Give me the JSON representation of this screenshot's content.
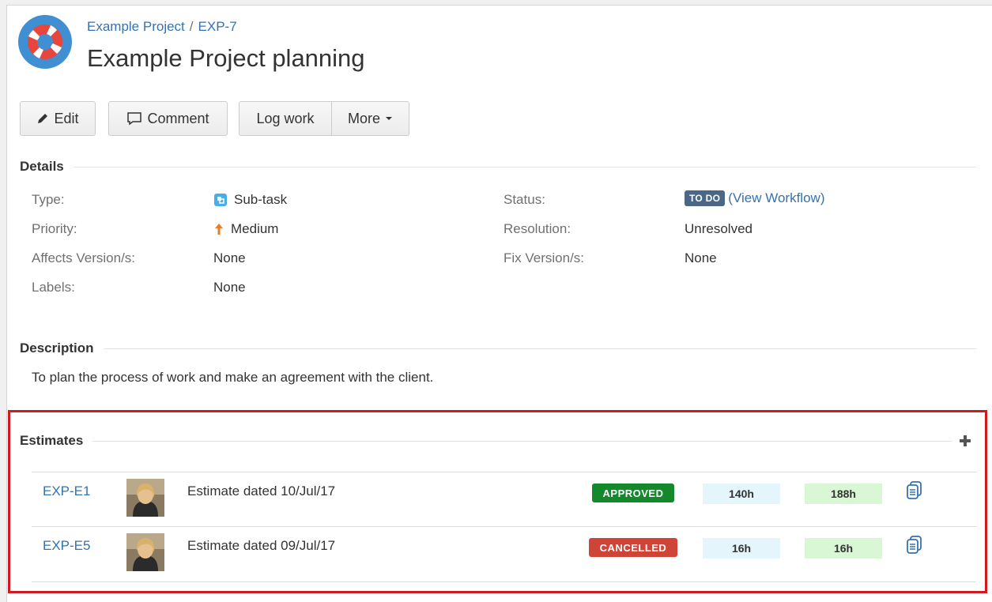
{
  "header": {
    "breadcrumb_project": "Example Project",
    "breadcrumb_sep": "/",
    "breadcrumb_issue": "EXP-7",
    "title": "Example Project planning",
    "project_icon": "lifebuoy-icon"
  },
  "toolbar": {
    "edit_label": "Edit",
    "comment_label": "Comment",
    "log_work_label": "Log work",
    "more_label": "More"
  },
  "details": {
    "heading": "Details",
    "type_label": "Type:",
    "type_value": "Sub-task",
    "priority_label": "Priority:",
    "priority_value": "Medium",
    "affects_label": "Affects Version/s:",
    "affects_value": "None",
    "labels_label": "Labels:",
    "labels_value": "None",
    "status_label": "Status:",
    "status_value": "TO DO",
    "view_workflow": "View Workflow",
    "resolution_label": "Resolution:",
    "resolution_value": "Unresolved",
    "fix_label": "Fix Version/s:",
    "fix_value": "None"
  },
  "description": {
    "heading": "Description",
    "text": "To plan the process of work and make an agreement with the client."
  },
  "estimates": {
    "heading": "Estimates",
    "rows": [
      {
        "key": "EXP-E1",
        "title": "Estimate dated 10/Jul/17",
        "status": "APPROVED",
        "status_color": "#14892c",
        "hours_a": "140h",
        "hours_b": "188h"
      },
      {
        "key": "EXP-E5",
        "title": "Estimate dated 09/Jul/17",
        "status": "CANCELLED",
        "status_color": "#d04437",
        "hours_a": "16h",
        "hours_b": "16h"
      }
    ]
  },
  "colors": {
    "link": "#3572b0",
    "highlight": "#d11a20",
    "hours_a_bg": "#e4f6fc",
    "hours_b_bg": "#d9f7d4"
  }
}
